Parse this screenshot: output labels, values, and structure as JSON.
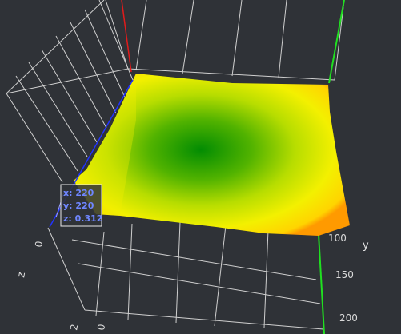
{
  "chart_data": {
    "type": "surface",
    "title": "",
    "axes": {
      "x": {
        "label": "",
        "ticks": [
          "2",
          "0"
        ]
      },
      "y": {
        "label": "y",
        "ticks": [
          "100",
          "150",
          "200"
        ]
      },
      "z": {
        "label": "z",
        "ticks": [
          "0"
        ]
      }
    },
    "colorscale": {
      "low": "#008a00",
      "mid": "#9ad000",
      "high": "#ffe600",
      "edge": "#ff8c00"
    },
    "grid": true,
    "hover": {
      "x_label": "x: 220",
      "y_label": "y: 220",
      "z_label": "z: 0.312"
    }
  },
  "colors": {
    "background": "#2f3237",
    "grid": "#cfcfcf",
    "axis_x": "#e21b1b",
    "axis_y": "#20e020",
    "axis_z": "#2233ff"
  }
}
